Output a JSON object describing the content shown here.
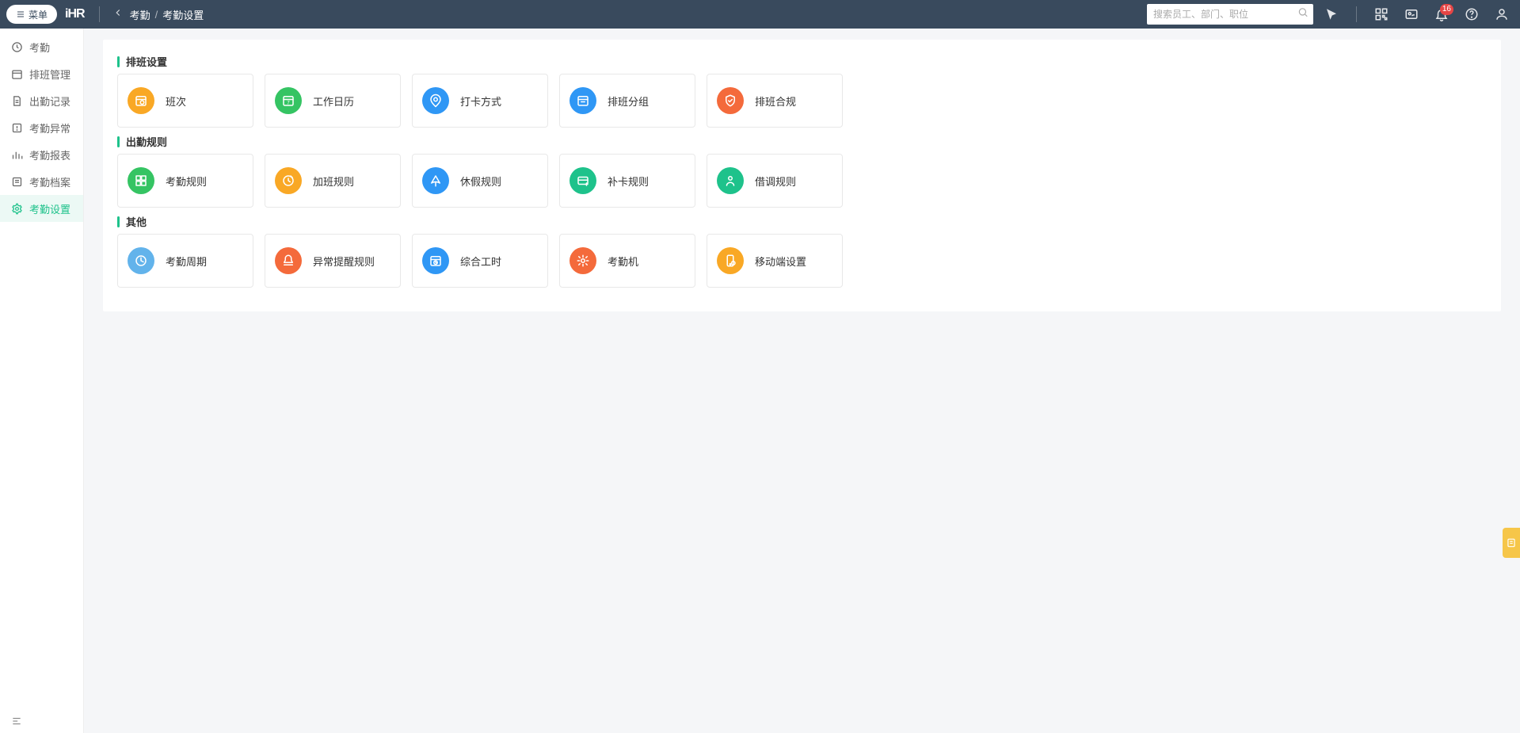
{
  "header": {
    "menu_label": "菜单",
    "logo": "iHR",
    "breadcrumb_root": "考勤",
    "breadcrumb_sep": "/",
    "breadcrumb_leaf": "考勤设置",
    "search_placeholder": "搜索员工、部门、职位",
    "notif_count": "16"
  },
  "sidebar": {
    "items": [
      {
        "label": "考勤"
      },
      {
        "label": "排班管理"
      },
      {
        "label": "出勤记录"
      },
      {
        "label": "考勤异常"
      },
      {
        "label": "考勤报表"
      },
      {
        "label": "考勤档案"
      },
      {
        "label": "考勤设置"
      }
    ]
  },
  "sections": [
    {
      "title": "排班设置",
      "cards": [
        {
          "label": "班次",
          "color": "c-orange",
          "icon": "shift"
        },
        {
          "label": "工作日历",
          "color": "c-green",
          "icon": "calendar"
        },
        {
          "label": "打卡方式",
          "color": "c-blue",
          "icon": "location"
        },
        {
          "label": "排班分组",
          "color": "c-blue",
          "icon": "group-cal"
        },
        {
          "label": "排班合规",
          "color": "c-redorange",
          "icon": "compliance"
        }
      ]
    },
    {
      "title": "出勤规则",
      "cards": [
        {
          "label": "考勤规则",
          "color": "c-green",
          "icon": "rules"
        },
        {
          "label": "加班规则",
          "color": "c-orange",
          "icon": "overtime"
        },
        {
          "label": "休假规则",
          "color": "c-blue",
          "icon": "vacation"
        },
        {
          "label": "补卡规则",
          "color": "c-teal",
          "icon": "recard"
        },
        {
          "label": "借调规则",
          "color": "c-teal",
          "icon": "secondment"
        }
      ]
    },
    {
      "title": "其他",
      "cards": [
        {
          "label": "考勤周期",
          "color": "c-lightblue",
          "icon": "cycle"
        },
        {
          "label": "异常提醒规则",
          "color": "c-redorange",
          "icon": "alert"
        },
        {
          "label": "综合工时",
          "color": "c-blue",
          "icon": "hours"
        },
        {
          "label": "考勤机",
          "color": "c-redorange",
          "icon": "device"
        },
        {
          "label": "移动端设置",
          "color": "c-orange",
          "icon": "mobile"
        }
      ]
    }
  ]
}
